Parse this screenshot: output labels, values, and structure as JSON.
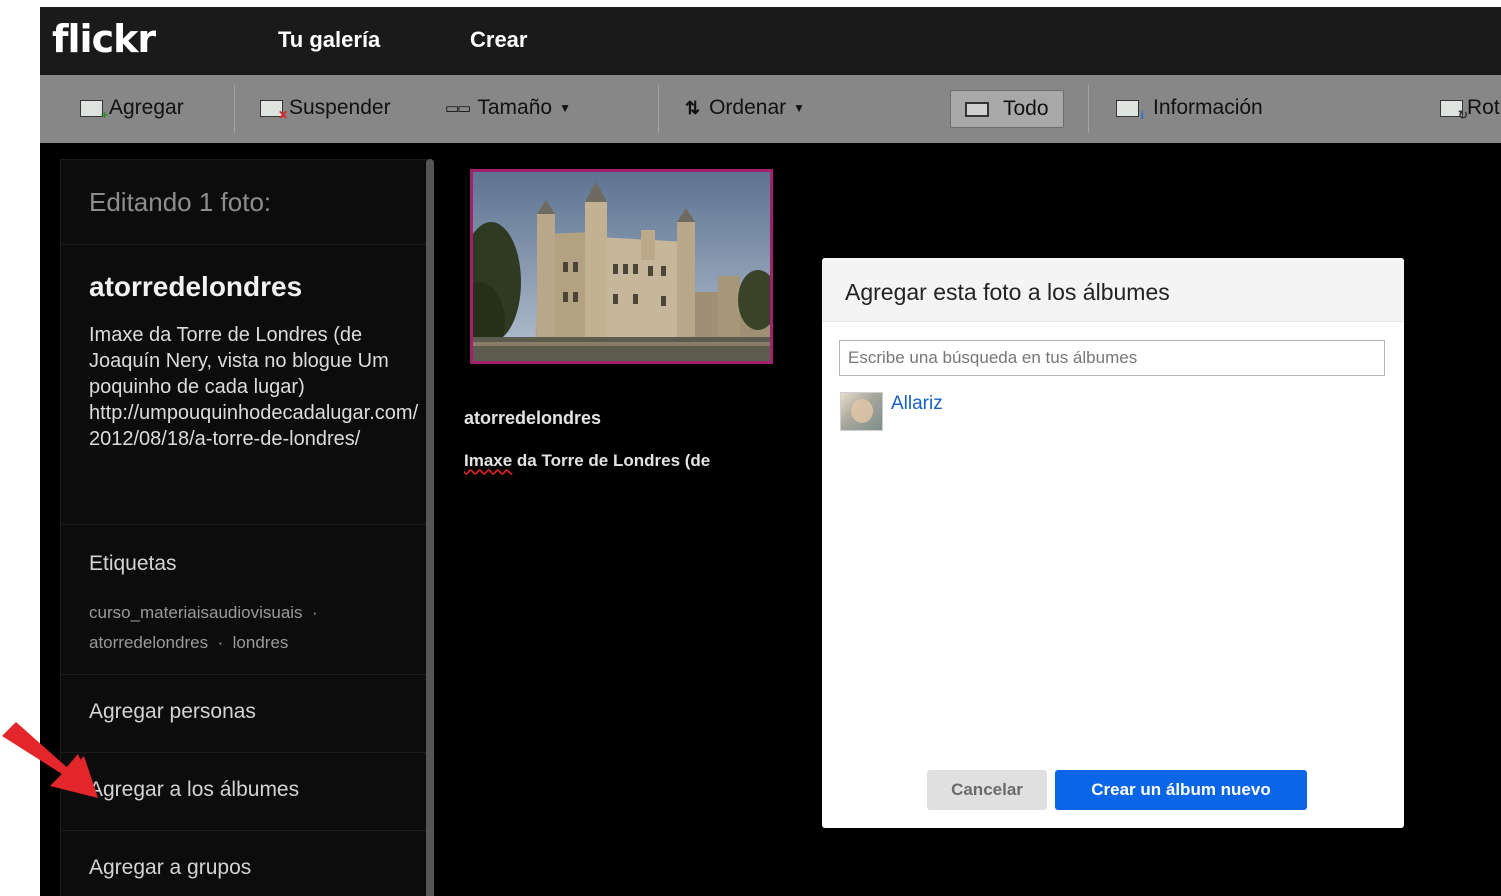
{
  "topnav": {
    "logo": "flickr",
    "gallery_label": "Tu galería",
    "create_label": "Crear"
  },
  "toolbar": {
    "add_label": "Agregar",
    "suspend_label": "Suspender",
    "size_label": "Tamaño",
    "sort_label": "Ordenar",
    "all_label": "Todo",
    "info_label": "Información",
    "rotate_label": "Rot"
  },
  "sidebar": {
    "editing_label": "Editando 1 foto:",
    "photo_title": "atorredelondres",
    "photo_description": "Imaxe da Torre de Londres (de  Joaquín Nery, vista no blogue Um poquinho de cada lugar) http://umpouquinhodecadalugar.com/2012/08/18/a-torre-de-londres/",
    "tags_label": "Etiquetas",
    "tags": [
      "curso_materiaisaudiovisuais",
      "atorredelondres",
      "londres"
    ],
    "tag_separator": "·",
    "add_people_label": "Agregar personas",
    "add_albums_label": "Agregar a los álbumes",
    "add_groups_label": "Agregar a grupos"
  },
  "photo_tile": {
    "title": "atorredelondres",
    "desc_first_word": "Imaxe",
    "desc_rest": " da Torre de Londres (de"
  },
  "dialog": {
    "title": "Agregar esta foto a los álbumes",
    "search_placeholder": "Escribe una búsqueda en tus álbumes",
    "search_value": "",
    "albums": [
      {
        "name": "Allariz"
      }
    ],
    "cancel_label": "Cancelar",
    "create_label": "Crear un álbum nuevo"
  },
  "colors": {
    "accent_blue": "#0a66e6",
    "link_blue": "#1860c5",
    "selection_border": "#a1216d",
    "annotation_arrow": "#e3262b"
  },
  "icons": {
    "add": "image-add-icon",
    "suspend": "image-remove-icon",
    "size": "size-icon",
    "sort": "sort-arrows-icon",
    "all": "screen-icon",
    "info": "image-info-icon",
    "rotate": "image-rotate-icon"
  }
}
